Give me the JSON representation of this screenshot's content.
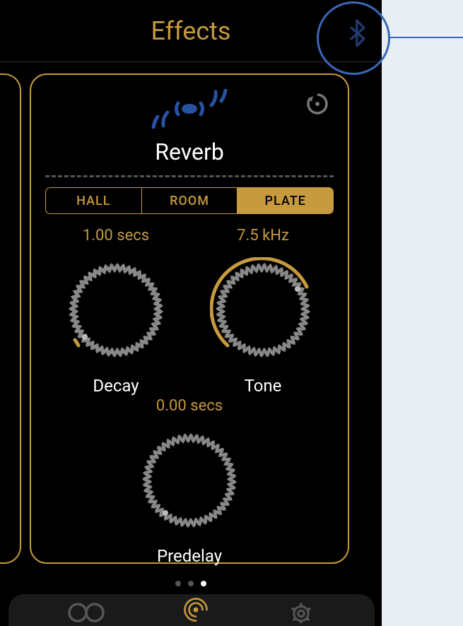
{
  "header": {
    "title": "Effects"
  },
  "effect": {
    "title": "Reverb",
    "modes": [
      {
        "label": "HALL",
        "active": false
      },
      {
        "label": "ROOM",
        "active": false
      },
      {
        "label": "PLATE",
        "active": true
      }
    ],
    "decay": {
      "value_text": "1.00 secs",
      "label": "Decay",
      "angle": -150
    },
    "tone": {
      "value_text": "7.5 kHz",
      "label": "Tone",
      "angle": -28,
      "arc_start": -225,
      "arc_end": -28
    },
    "predelay": {
      "value_text": "0.00 secs",
      "label": "Predelay",
      "angle": -125
    }
  },
  "pagination": {
    "pages": 3,
    "active": 3
  },
  "colors": {
    "accent": "#c69a3e",
    "bluetooth": "#1f3a6b",
    "callout": "#3a68b7"
  }
}
